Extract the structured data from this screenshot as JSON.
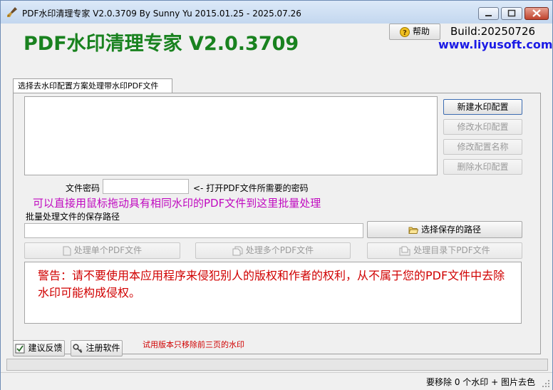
{
  "window": {
    "title": "PDF水印清理专家 V2.0.3709 By Sunny Yu 2015.01.25 - 2025.07.26"
  },
  "header": {
    "heading": "PDF水印清理专家 V2.0.3709",
    "help_label": "帮助",
    "build": "Build:20250726",
    "website": "www.liyusoft.com"
  },
  "tab": {
    "label": "选择去水印配置方案处理带水印PDF文件"
  },
  "config_buttons": {
    "new": "新建水印配置",
    "edit": "修改水印配置",
    "rename": "修改配置名称",
    "delete": "删除水印配置"
  },
  "password": {
    "label": "文件密码",
    "value": "",
    "hint": "<- 打开PDF文件所需要的密码"
  },
  "drag_hint": "可以直接用鼠标拖动具有相同水印的PDF文件到这里批量处理",
  "save_path": {
    "label": "批量处理文件的保存路径",
    "value": "",
    "choose_button": "选择保存的路径"
  },
  "process_buttons": {
    "single": "处理单个PDF文件",
    "multiple": "处理多个PDF文件",
    "directory": "处理目录下PDF文件"
  },
  "warning": "警告：请不要使用本应用程序来侵犯别人的版权和作者的权利，从不属于您的PDF文件中去除水印可能构成侵权。",
  "footer": {
    "feedback": "建议反馈",
    "register": "注册软件",
    "trial_note": "试用版本只移除前三页的水印"
  },
  "status": {
    "text": "要移除 0 个水印 + 图片去色"
  },
  "colors": {
    "heading": "#19821f",
    "website": "#1a1ae6",
    "hint": "#c00ac0",
    "warning": "#d00000"
  },
  "icons": {
    "app": "brush-icon",
    "help": "question-icon",
    "folder": "folder-icon",
    "file": "file-icon",
    "files": "files-icon",
    "directory": "directory-icon",
    "feedback": "feedback-icon",
    "register": "key-icon"
  }
}
